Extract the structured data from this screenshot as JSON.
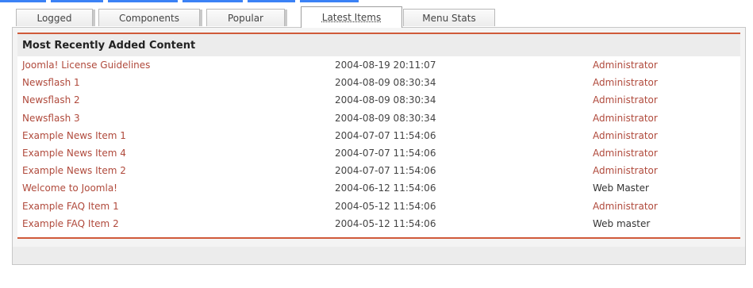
{
  "tabs": [
    {
      "label": "Logged"
    },
    {
      "label": "Components"
    },
    {
      "label": "Popular"
    },
    {
      "label": "Latest Items"
    },
    {
      "label": "Menu Stats"
    }
  ],
  "active_tab_index": 3,
  "panel": {
    "heading": "Most Recently Added Content",
    "rows": [
      {
        "title": "Joomla! License Guidelines",
        "date": "2004-08-19 20:11:07",
        "author": "Administrator"
      },
      {
        "title": "Newsflash 1",
        "date": "2004-08-09 08:30:34",
        "author": "Administrator"
      },
      {
        "title": "Newsflash 2",
        "date": "2004-08-09 08:30:34",
        "author": "Administrator"
      },
      {
        "title": "Newsflash 3",
        "date": "2004-08-09 08:30:34",
        "author": "Administrator"
      },
      {
        "title": "Example News Item 1",
        "date": "2004-07-07 11:54:06",
        "author": "Administrator"
      },
      {
        "title": "Example News Item 4",
        "date": "2004-07-07 11:54:06",
        "author": "Administrator"
      },
      {
        "title": "Example News Item 2",
        "date": "2004-07-07 11:54:06",
        "author": "Administrator"
      },
      {
        "title": "Welcome to Joomla!",
        "date": "2004-06-12 11:54:06",
        "author": "Web Master"
      },
      {
        "title": "Example FAQ Item 1",
        "date": "2004-05-12 11:54:06",
        "author": "Administrator"
      },
      {
        "title": "Example FAQ Item 2",
        "date": "2004-05-12 11:54:06",
        "author": "Web master"
      }
    ]
  },
  "colors": {
    "accent": "#d05a3a",
    "link": "#b04a3c",
    "top_line": "#3b82f6"
  }
}
